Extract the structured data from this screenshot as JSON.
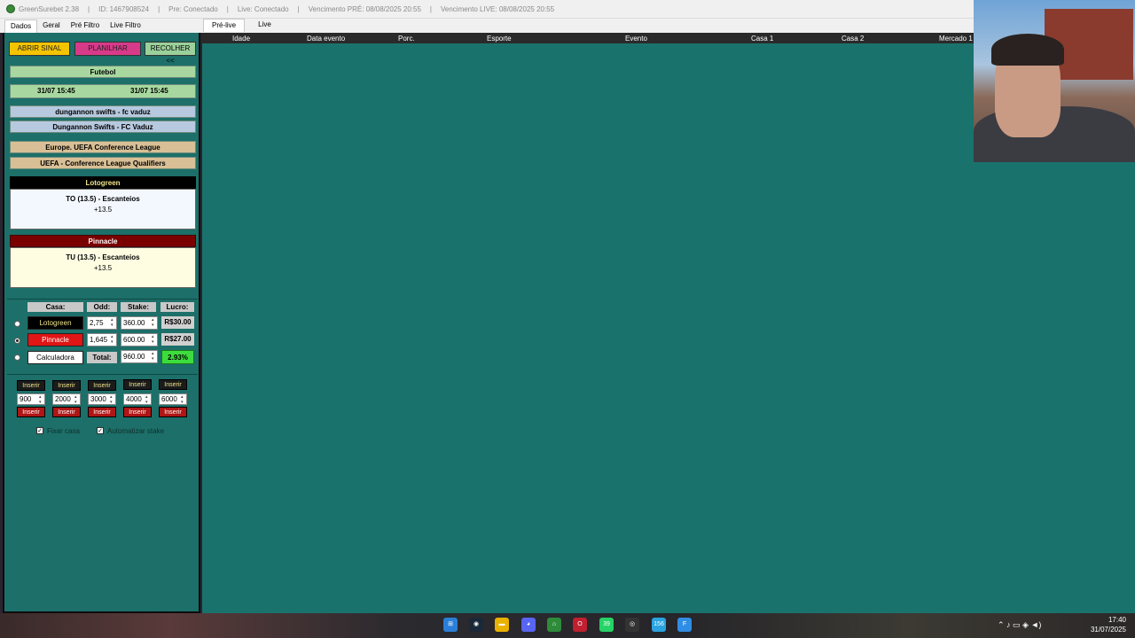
{
  "titlebar": {
    "app": "GreenSurebet 2.38",
    "id": "ID: 1467908524",
    "pre": "Pre: Conectado",
    "live": "Live: Conectado",
    "venc_pre": "Vencimento PRÉ: 08/08/2025 20:55",
    "venc_live": "Vencimento LIVE: 08/08/2025 20:55",
    "sep": "|"
  },
  "tabs": [
    "Dados",
    "Geral",
    "Pré Filtro",
    "Live Filtro"
  ],
  "subtabs": [
    "Pré-live",
    "Live"
  ],
  "buttons": {
    "abrir": "ABRIR SINAL",
    "planilhar": "PLANILHAR",
    "recolher": "RECOLHER <<"
  },
  "info": {
    "sport": "Futebol",
    "date1": "31/07 15:45",
    "date2": "31/07 15:45",
    "match1": "dungannon swifts - fc vaduz",
    "match2": "Dungannon Swifts - FC Vaduz",
    "league1": "Europe. UEFA Conference League",
    "league2": "UEFA - Conference League Qualifiers"
  },
  "bet1": {
    "house": "Lotogreen",
    "market": "TO (13.5) - Escanteios",
    "line": "+13.5"
  },
  "bet2": {
    "house": "Pinnacle",
    "market": "TU (13.5) - Escanteios",
    "line": "+13.5"
  },
  "calc": {
    "h_casa": "Casa:",
    "h_odd": "Odd:",
    "h_stake": "Stake:",
    "h_lucro": "Lucro:",
    "row1_house": "Lotogreen",
    "row1_odd": "2,75",
    "row1_stake": "360.00",
    "row1_lucro": "R$30.00",
    "row2_house": "Pinnacle",
    "row2_odd": "1,645",
    "row2_stake": "600.00",
    "row2_lucro": "R$27.00",
    "row3_house": "Calculadora",
    "total_label": "Total:",
    "total_stake": "960.00",
    "percent": "2.93%"
  },
  "stakes": {
    "inserir": "Inserir",
    "values": [
      "900",
      "2000",
      "3000",
      "4000",
      "6000"
    ]
  },
  "options": {
    "fixar": "Fixar casa",
    "automatizar": "Automatizar stake"
  },
  "table_headers": [
    "Idade",
    "Data evento",
    "Porc.",
    "Esporte",
    "Evento",
    "Casa 1",
    "Casa 2",
    "Mercado 1"
  ],
  "clock": {
    "time": "17:40",
    "date": "31/07/2025"
  },
  "taskbar_badges": {
    "whatsapp": "39",
    "telegram": "156"
  },
  "colors": {
    "panel": "#1d6f69",
    "lotogreen": "#000000",
    "pinnacle": "#7a0000",
    "accent": "#f5c400"
  }
}
